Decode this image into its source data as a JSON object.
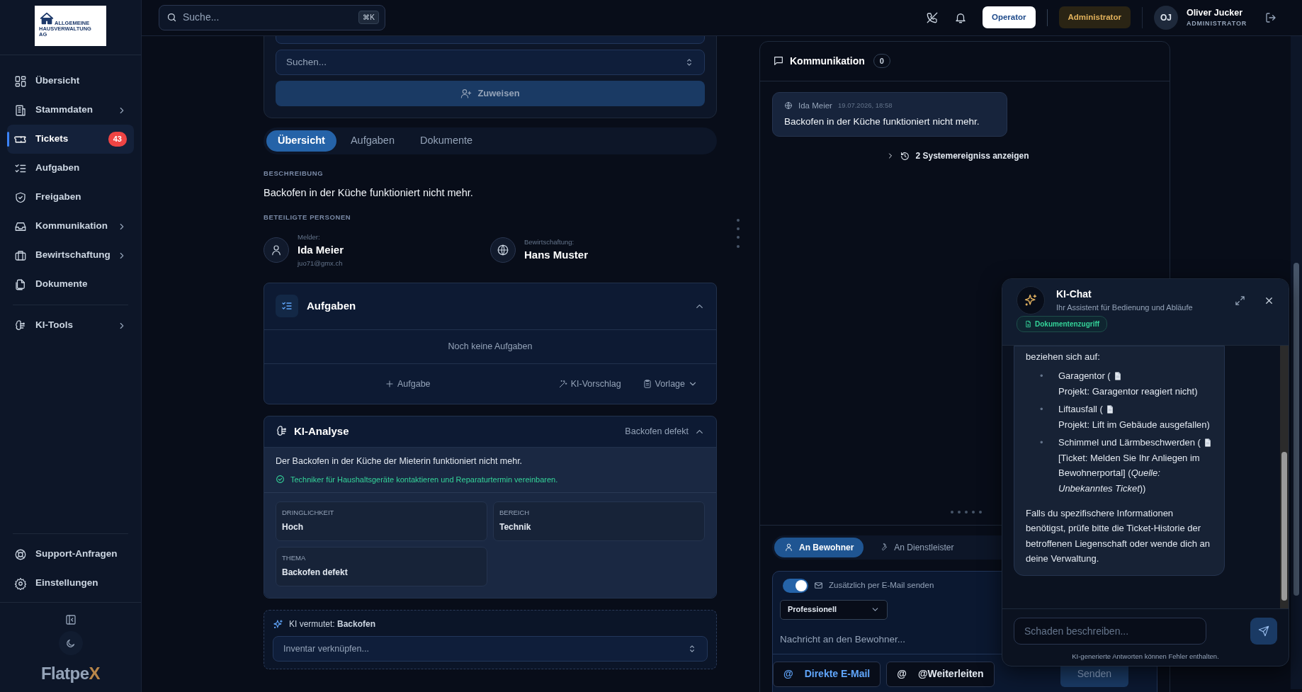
{
  "sidebar": {
    "logo": {
      "lines": [
        "ALLGEMEINE",
        "HAUSVERWALTUNG",
        "AG"
      ]
    },
    "items": [
      {
        "label": "Übersicht",
        "selected": false,
        "expandable": false
      },
      {
        "label": "Stammdaten",
        "selected": false,
        "expandable": true
      },
      {
        "label": "Tickets",
        "selected": true,
        "expandable": false,
        "badge": "43"
      },
      {
        "label": "Aufgaben",
        "selected": false,
        "expandable": false
      },
      {
        "label": "Freigaben",
        "selected": false,
        "expandable": false
      },
      {
        "label": "Kommunikation",
        "selected": false,
        "expandable": true
      },
      {
        "label": "Bewirtschaftung",
        "selected": false,
        "expandable": true
      },
      {
        "label": "Dokumente",
        "selected": false,
        "expandable": false
      },
      {
        "label": "KI-Tools",
        "selected": false,
        "expandable": true
      }
    ],
    "footer_items": [
      {
        "label": "Support-Anfragen",
        "selected": false
      },
      {
        "label": "Einstellungen",
        "selected": false
      }
    ],
    "brand": {
      "text": "Flatpe",
      "accent": "X"
    }
  },
  "topbar": {
    "search": {
      "placeholder": "Suche...",
      "shortcut": "⌘K"
    },
    "roles": [
      {
        "label": "Operator",
        "selected": true
      },
      {
        "label": "Administrator",
        "selected": false
      }
    ],
    "user": {
      "initials": "OJ",
      "name": "Oliver Jucker",
      "role": "ADMINISTRATOR"
    }
  },
  "assign": {
    "select_placeholder": "Suchen...",
    "button": "Zuweisen"
  },
  "tabs": [
    {
      "label": "Übersicht",
      "selected": true
    },
    {
      "label": "Aufgaben",
      "selected": false
    },
    {
      "label": "Dokumente",
      "selected": false
    }
  ],
  "description": {
    "heading": "BESCHREIBUNG",
    "text": "Backofen in der Küche funktioniert nicht mehr."
  },
  "persons": {
    "heading": "BETEILIGTE PERSONEN",
    "items": [
      {
        "role": "Melder:",
        "name": "Ida Meier",
        "email": "juo71@gmx.ch"
      },
      {
        "role": "Bewirtschaftung:",
        "name": "Hans Muster"
      }
    ]
  },
  "tasks": {
    "title": "Aufgaben",
    "expanded": true,
    "empty_text": "Noch keine Aufgaben",
    "actions": [
      "Aufgabe",
      "KI-Vorschlag",
      "Vorlage"
    ]
  },
  "ai_analysis": {
    "title": "KI-Analyse",
    "topic": "Backofen defekt",
    "expanded": true,
    "summary": "Der Backofen in der Küche der Mieterin funktioniert nicht mehr.",
    "recommendation": "Techniker für Haushaltsgeräte kontaktieren und Reparaturtermin vereinbaren.",
    "fields": [
      {
        "label": "DRINGLICHKEIT",
        "value": "Hoch"
      },
      {
        "label": "BEREICH",
        "value": "Technik"
      },
      {
        "label": "THEMA",
        "value": "Backofen defekt"
      }
    ]
  },
  "ai_guess": {
    "text": "KI vermutet: **Backofen**",
    "placeholder": "Inventar verknüpfen..."
  },
  "communication": {
    "title": "Kommunikation",
    "count": "0",
    "messages": [
      {
        "author": "Ida Meier",
        "time": "19.07.2026, 18:58",
        "text": "Backofen in der Küche funktioniert nicht mehr."
      }
    ],
    "system_events": "2 Systemereigniss anzeigen",
    "recipient_tabs": [
      {
        "label": "An Bewohner",
        "selected": true
      },
      {
        "label": "An Dienstleister",
        "selected": false
      }
    ],
    "email_toggle": {
      "label": "Zusätzlich per E-Mail senden",
      "on": true
    },
    "tone": "Professionell",
    "placeholder": "Nachricht an den Bewohner...",
    "buttons": [
      {
        "icon": "@",
        "label": "Direkte E-Mail"
      },
      {
        "icon": "@",
        "label": "@Weiterleiten"
      }
    ],
    "send": "Senden"
  },
  "chat": {
    "title": "KI-Chat",
    "subtitle": "Ihr Assistent für Bedienung und Abläufe",
    "badge": "Dokumentenzugriff",
    "intro": "beziehen sich auf:",
    "items": [
      {
        "bullet": "•",
        "before": "Garagentor (",
        "after": "Projekt: Garagentor reagiert nicht)"
      },
      {
        "bullet": "•",
        "before": "Liftausfall (",
        "after": "Projekt: Lift im Gebäude ausgefallen)"
      },
      {
        "bullet": "•",
        "before": "Schimmel und Lärmbeschwerden (",
        "after": "[Ticket: Melden Sie Ihr Anliegen im Bewohnerportal] (*Quelle: Unbekanntes Ticket*))"
      }
    ],
    "outro": "Falls du spezifischere Informationen benötigst, prüfe bitte die Ticket-Historie der betroffenen Liegenschaft oder wende dich an deine Verwaltung.",
    "placeholder": "Schaden beschreiben...",
    "disclaimer": "KI-generierte Antworten können Fehler enthalten."
  }
}
